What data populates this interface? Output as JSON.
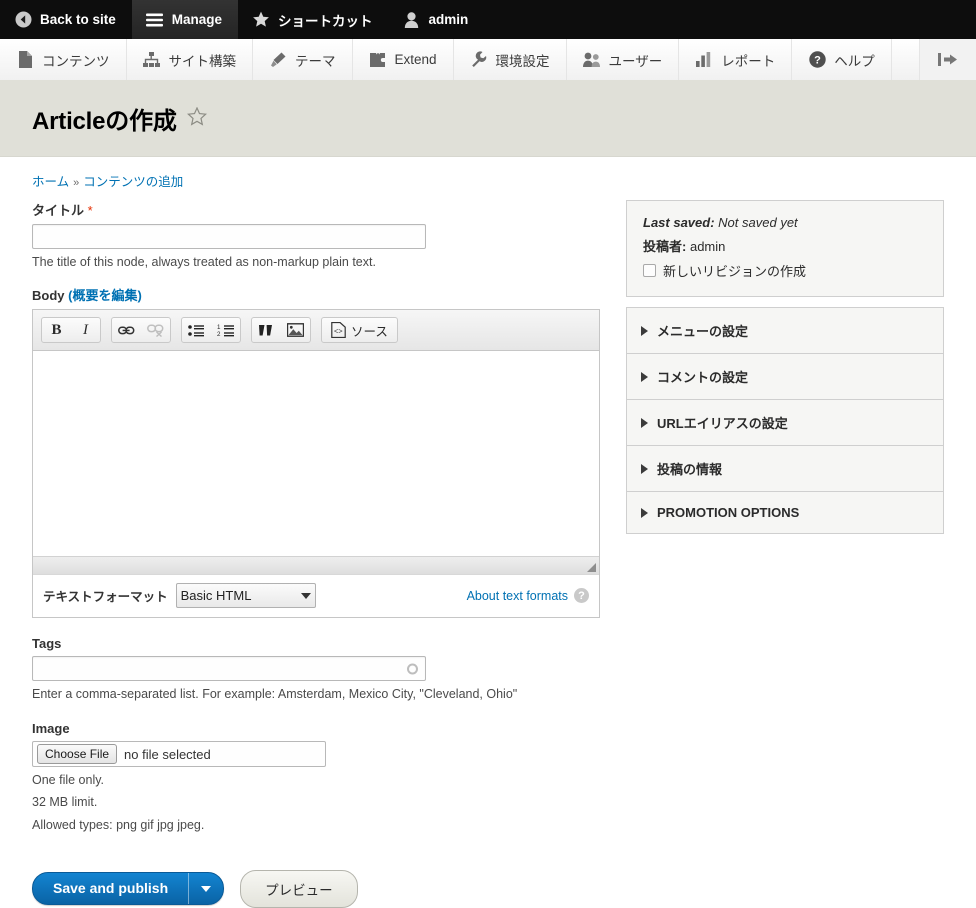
{
  "toolbar": {
    "tabs": [
      {
        "label": "Back to site",
        "icon": "back-arrow-icon",
        "active": false
      },
      {
        "label": "Manage",
        "icon": "hamburger-icon",
        "active": true
      },
      {
        "label": "ショートカット",
        "icon": "star-icon",
        "active": false
      },
      {
        "label": "admin",
        "icon": "user-icon",
        "active": false
      }
    ]
  },
  "menu": {
    "items": [
      {
        "label": "コンテンツ",
        "icon": "document-icon"
      },
      {
        "label": "サイト構築",
        "icon": "sitemap-icon"
      },
      {
        "label": "テーマ",
        "icon": "paintbrush-icon"
      },
      {
        "label": "Extend",
        "icon": "puzzle-icon"
      },
      {
        "label": "環境設定",
        "icon": "wrench-icon"
      },
      {
        "label": "ユーザー",
        "icon": "people-icon"
      },
      {
        "label": "レポート",
        "icon": "bar-chart-icon"
      },
      {
        "label": "ヘルプ",
        "icon": "question-mark-icon"
      }
    ],
    "collapse_icon": "collapse-tray-icon"
  },
  "page": {
    "title": "Articleの作成",
    "shortcut_icon": "star-outline-icon"
  },
  "breadcrumb": {
    "home": "ホーム",
    "separator": "»",
    "current": "コンテンツの追加"
  },
  "form": {
    "title_field": {
      "label": "タイトル",
      "required_mark": "*",
      "value": "",
      "placeholder": "",
      "description": "The title of this node, always treated as non-markup plain text."
    },
    "body_field": {
      "label": "Body",
      "summary_link": "(概要を編集)",
      "value": "",
      "toolbar_buttons": [
        {
          "name": "bold",
          "icon": "bold-icon",
          "glyph": "B",
          "disabled": false
        },
        {
          "name": "italic",
          "icon": "italic-icon",
          "glyph": "I",
          "disabled": false
        },
        {
          "name": "link",
          "icon": "link-icon",
          "glyph": "",
          "disabled": false
        },
        {
          "name": "unlink",
          "icon": "unlink-icon",
          "glyph": "",
          "disabled": true
        },
        {
          "name": "bulleted-list",
          "icon": "bulleted-list-icon",
          "glyph": "",
          "disabled": false
        },
        {
          "name": "numbered-list",
          "icon": "numbered-list-icon",
          "glyph": "",
          "disabled": false
        },
        {
          "name": "blockquote",
          "icon": "quote-icon",
          "glyph": "",
          "disabled": false
        },
        {
          "name": "image",
          "icon": "image-icon",
          "glyph": "",
          "disabled": false
        },
        {
          "name": "source",
          "icon": "source-code-icon",
          "glyph": "",
          "label": "ソース",
          "disabled": false
        }
      ],
      "format_label": "テキストフォーマット",
      "format_value": "Basic HTML",
      "format_options": [
        "Basic HTML"
      ],
      "about_link": "About text formats",
      "help_glyph": "?"
    },
    "tags_field": {
      "label": "Tags",
      "value": "",
      "placeholder": "",
      "description": "Enter a comma-separated list. For example: Amsterdam, Mexico City, \"Cleveland, Ohio\""
    },
    "image_field": {
      "label": "Image",
      "choose_button": "Choose File",
      "file_status": "no file selected",
      "descriptions": [
        "One file only.",
        "32 MB limit.",
        "Allowed types: png gif jpg jpeg."
      ]
    }
  },
  "actions": {
    "save_label": "Save and publish",
    "save_dropdown_icon": "caret-down-icon",
    "preview_label": "プレビュー"
  },
  "sidebar": {
    "meta": {
      "last_saved_label": "Last saved:",
      "last_saved_value": "Not saved yet",
      "author_label": "投稿者:",
      "author_value": "admin",
      "revision_checkbox_label": "新しいリビジョンの作成",
      "revision_checked": false
    },
    "sections": [
      {
        "label": "メニューの設定",
        "expanded": false
      },
      {
        "label": "コメントの設定",
        "expanded": false
      },
      {
        "label": "URLエイリアスの設定",
        "expanded": false
      },
      {
        "label": "投稿の情報",
        "expanded": false
      },
      {
        "label": "PROMOTION OPTIONS",
        "expanded": false
      }
    ]
  },
  "colors": {
    "toolbar_bg": "#0d0d0d",
    "toolbar_active": "#2b2b2b",
    "title_bar_bg": "#e0e0d8",
    "link": "#0071b3",
    "required": "#e42d00",
    "primary_button": "#1078bf"
  }
}
